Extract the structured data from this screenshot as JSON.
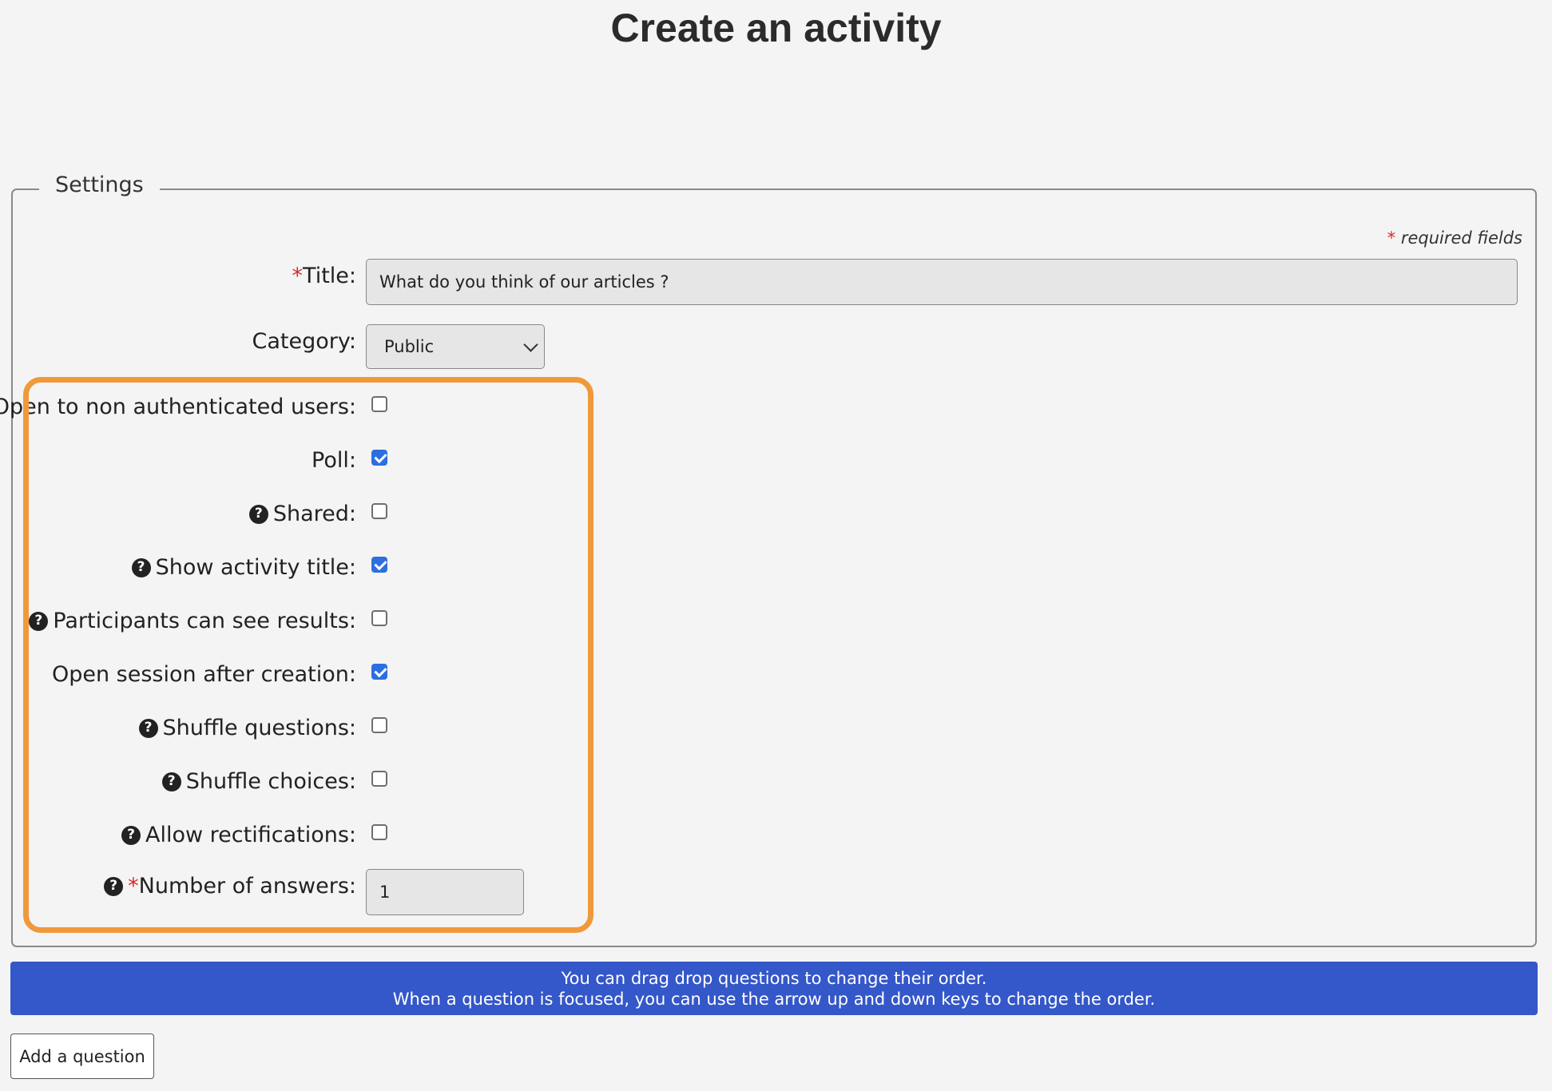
{
  "page": {
    "title": "Create an activity"
  },
  "settings": {
    "legend": "Settings",
    "required_note": "required fields",
    "required_star": "*",
    "title_field": {
      "label": "Title:",
      "value": "What do you think of our articles ?"
    },
    "category_field": {
      "label": "Category:",
      "value": "Public"
    },
    "options": [
      {
        "label": "Open to non authenticated users:",
        "help": false,
        "checked": false
      },
      {
        "label": "Poll:",
        "help": false,
        "checked": true
      },
      {
        "label": "Shared:",
        "help": true,
        "checked": false
      },
      {
        "label": "Show activity title:",
        "help": true,
        "checked": true
      },
      {
        "label": "Participants can see results:",
        "help": true,
        "checked": false
      },
      {
        "label": "Open session after creation:",
        "help": false,
        "checked": true
      },
      {
        "label": "Shuffle questions:",
        "help": true,
        "checked": false
      },
      {
        "label": "Shuffle choices:",
        "help": true,
        "checked": false
      },
      {
        "label": "Allow rectifications:",
        "help": true,
        "checked": false
      }
    ],
    "answers_field": {
      "label": "Number of answers:",
      "value": "1"
    }
  },
  "info_banner": {
    "line1": "You can drag drop questions to change their order.",
    "line2": "When a question is focused, you can use the arrow up and down keys to change the order."
  },
  "actions": {
    "add_question_label": "Add a question"
  },
  "colors": {
    "highlight": "#f0993a",
    "banner": "#3457c9",
    "checkbox_checked": "#2c6fe0",
    "required_star": "#d62b2b"
  },
  "icons": {
    "help": "question-circle-icon",
    "select_arrow": "chevron-down-icon"
  }
}
